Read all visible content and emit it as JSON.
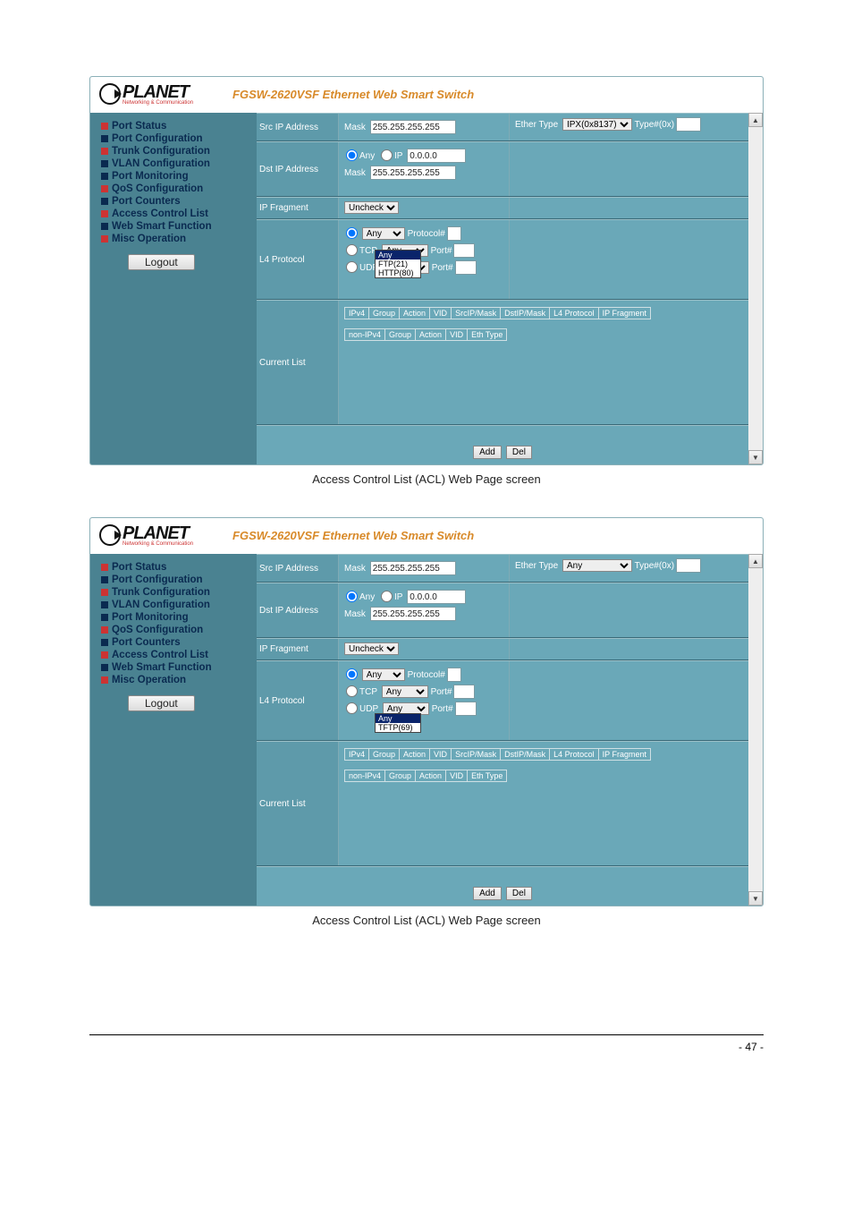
{
  "brand": {
    "name": "PLANET",
    "tagline": "Networking & Communication"
  },
  "product_title": "FGSW-2620VSF Ethernet Web Smart Switch",
  "nav": {
    "items": [
      "Port Status",
      "Port Configuration",
      "Trunk Configuration",
      "VLAN Configuration",
      "Port Monitoring",
      "QoS Configuration",
      "Port Counters",
      "Access Control List",
      "Web Smart Function",
      "Misc Operation"
    ],
    "logout_label": "Logout"
  },
  "form": {
    "src_ip_label": "Src IP Address",
    "dst_ip_label": "Dst IP Address",
    "ip_fragment_label": "IP Fragment",
    "l4_protocol_label": "L4 Protocol",
    "current_list_label": "Current List",
    "ether_type_label": "Ether Type",
    "mask_label": "Mask",
    "any_label": "Any",
    "ip_label": "IP",
    "ip_placeholder": "0.0.0.0",
    "mask_value": "255.255.255.255",
    "uncheck_label": "Uncheck",
    "protocol_hash": "Protocol#",
    "tcp_label": "TCP",
    "udp_label": "UDP",
    "port_hash": "Port#",
    "type_hash": "Type#(0x)"
  },
  "ether_type_1": {
    "selected": "IPX(0x8137)"
  },
  "ether_type_2": {
    "selected": "Any"
  },
  "l4_dropdown_1": {
    "tcp_selected": "Any",
    "udp_selected": "FTP(21)",
    "overlay_top": "Any",
    "overlay_options": [
      "FTP(21)",
      "HTTP(80)"
    ]
  },
  "l4_dropdown_2": {
    "tcp_selected": "Any",
    "udp_selected": "Any",
    "overlay_top": "Any",
    "overlay_options": [
      "TFTP(69)"
    ]
  },
  "tables": {
    "ipv4_headers": [
      "IPv4",
      "Group",
      "Action",
      "VID",
      "SrcIP/Mask",
      "DstIP/Mask",
      "L4 Protocol",
      "IP Fragment"
    ],
    "nonipv4_headers": [
      "non-IPv4",
      "Group",
      "Action",
      "VID",
      "Eth Type"
    ]
  },
  "buttons": {
    "add": "Add",
    "del": "Del"
  },
  "caption": "Access Control List (ACL) Web Page screen",
  "page_number": "- 47 -"
}
